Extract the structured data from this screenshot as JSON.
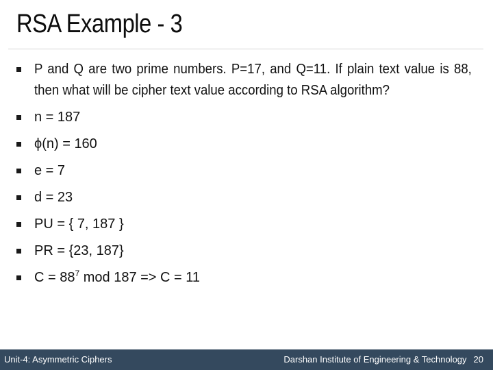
{
  "slide": {
    "title": "RSA Example - 3",
    "question": "P and Q are two prime numbers. P=17, and Q=11. If plain text value is 88, then what will be cipher text value according to RSA algorithm?",
    "steps": [
      "n = 187",
      "ϕ(n) = 160",
      "e = 7",
      "d = 23",
      "PU = { 7, 187 }",
      "PR = {23, 187}"
    ],
    "final_step": {
      "prefix": "C = 88",
      "exponent": "7",
      "suffix": " mod 187 => C = 11"
    }
  },
  "footer": {
    "left": "Unit-4: Asymmetric Ciphers",
    "institute": "Darshan Institute of Engineering & Technology",
    "page": "20",
    "background": "#34495e"
  },
  "icons": {
    "bullet": "square-bullet-icon"
  }
}
